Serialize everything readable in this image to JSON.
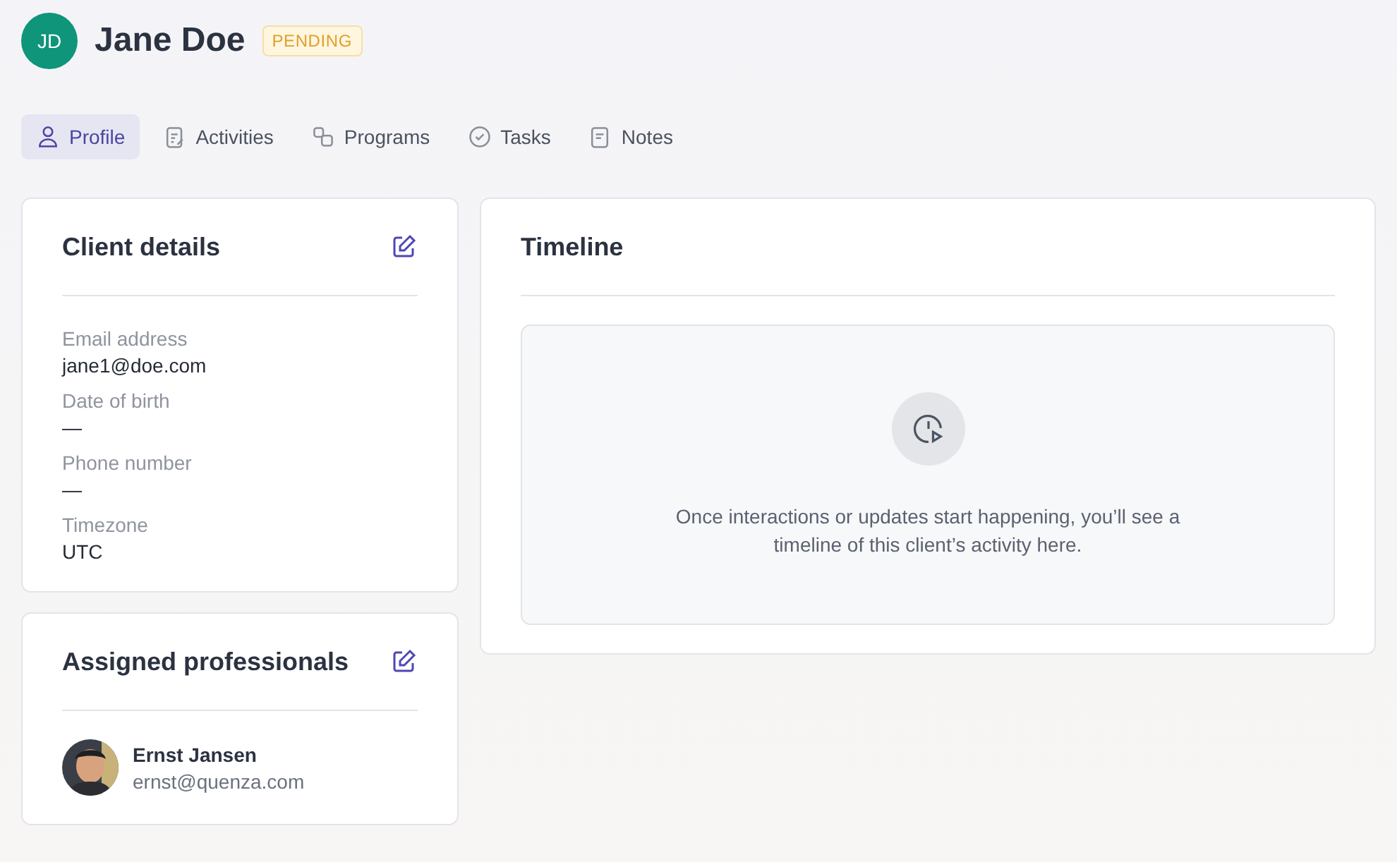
{
  "header": {
    "initials": "JD",
    "name": "Jane Doe",
    "status": "PENDING"
  },
  "tabs": [
    {
      "kind": "profile",
      "label": "Profile",
      "selected": true
    },
    {
      "kind": "activities",
      "label": "Activities",
      "selected": false
    },
    {
      "kind": "programs",
      "label": "Programs",
      "selected": false
    },
    {
      "kind": "tasks",
      "label": "Tasks",
      "selected": false
    },
    {
      "kind": "notes",
      "label": "Notes",
      "selected": false
    }
  ],
  "client_details": {
    "title": "Client details",
    "fields": [
      {
        "label": "Email address",
        "value": "jane1@doe.com"
      },
      {
        "label": "Date of birth",
        "value": "—"
      },
      {
        "label": "Phone number",
        "value": "—"
      },
      {
        "label": "Timezone",
        "value": "UTC"
      }
    ]
  },
  "assigned_professionals": {
    "title": "Assigned professionals",
    "people": [
      {
        "name": "Ernst Jansen",
        "email": "ernst@quenza.com"
      }
    ]
  },
  "timeline": {
    "title": "Timeline",
    "empty_message": "Once interactions or updates start happening, you’ll see a timeline of this client’s activity here."
  }
}
